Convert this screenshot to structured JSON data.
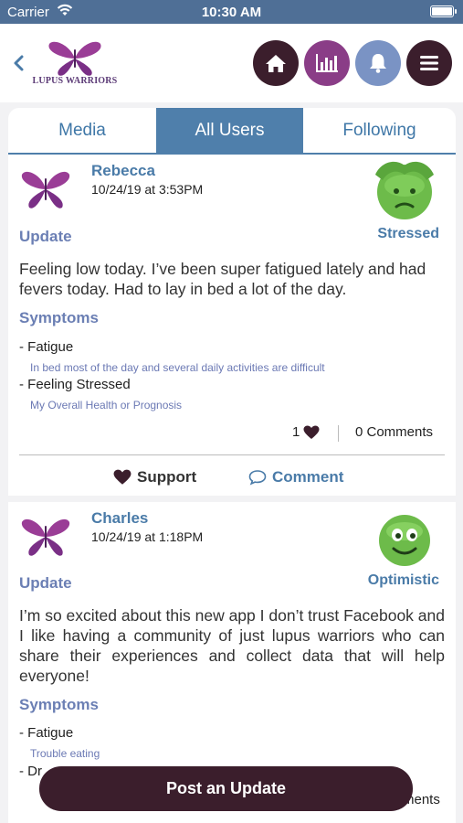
{
  "status_bar": {
    "carrier": "Carrier",
    "time": "10:30 AM"
  },
  "header": {
    "logo_text": "LUPUS WARRIORS",
    "nav_icons": [
      "home-icon",
      "chart-icon",
      "bell-icon",
      "menu-icon"
    ]
  },
  "tabs": [
    {
      "label": "Media",
      "active": false
    },
    {
      "label": "All Users",
      "active": true
    },
    {
      "label": "Following",
      "active": false
    }
  ],
  "posts": [
    {
      "user": "Rebecca",
      "date": "10/24/19 at 3:53PM",
      "type_label": "Update",
      "mood": "Stressed",
      "text": "Feeling low today. I’ve been super fatigued lately and had fevers today. Had to lay in bed a lot of the day.",
      "symptoms_label": "Symptoms",
      "symptoms": [
        {
          "name": "- Fatigue",
          "note": "In bed most of the day and several daily activities are difficult"
        },
        {
          "name": "- Feeling Stressed",
          "note": "My Overall Health or Prognosis"
        }
      ],
      "likes": "1",
      "comments": "0 Comments",
      "support_label": "Support",
      "comment_label": "Comment"
    },
    {
      "user": "Charles",
      "date": "10/24/19 at 1:18PM",
      "type_label": "Update",
      "mood": "Optimistic",
      "text": "I’m so excited about this new app I don’t trust Facebook and I like having a community of just lupus warriors who can share their experiences and collect data that will help everyone!",
      "symptoms_label": "Symptoms",
      "symptoms": [
        {
          "name": "- Fatigue",
          "note": "Trouble eating"
        },
        {
          "name": "- Dr"
        }
      ],
      "comments_partial": "ments"
    }
  ],
  "post_update_button": "Post an Update",
  "colors": {
    "accent_blue": "#4f7fab",
    "dark_plum": "#3b1e2c",
    "purple": "#8a3d87",
    "periwinkle": "#7a93c4",
    "label_lavender": "#6b7fb4"
  }
}
